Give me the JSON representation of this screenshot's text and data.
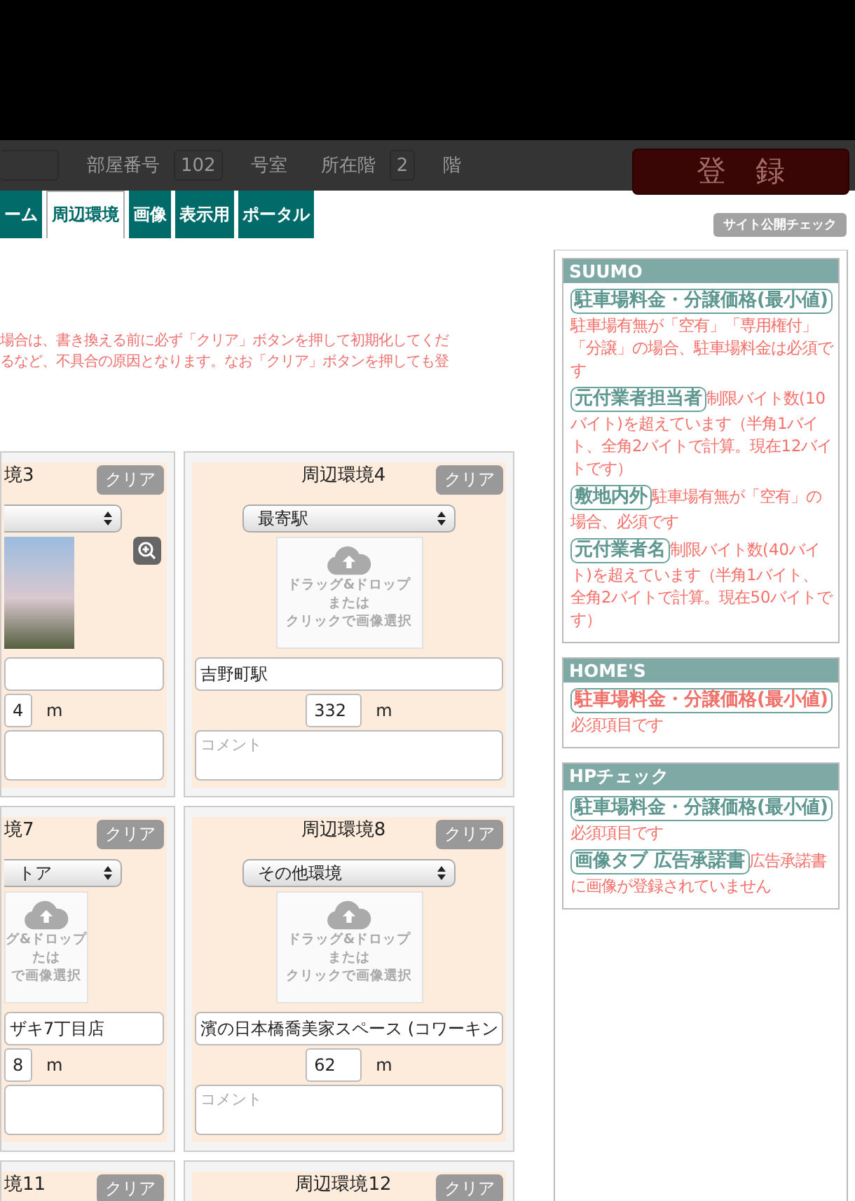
{
  "header": {
    "fields": [
      {
        "kind": "cut"
      },
      {
        "label": "部屋番号",
        "value": "102",
        "unit": "号室"
      },
      {
        "label": "所在階",
        "value": "2",
        "unit": "階"
      }
    ],
    "register_button": "登　録"
  },
  "tabs": [
    {
      "label": "ーム",
      "selected": false
    },
    {
      "label": "周辺環境",
      "selected": true
    },
    {
      "label": "画像",
      "selected": false
    },
    {
      "label": "表示用",
      "selected": false
    },
    {
      "label": "ポータル",
      "selected": false
    }
  ],
  "site_check_button": "サイト公開チェック",
  "warning": [
    "場合は、書き換える前に必ず「クリア」ボタンを押して初期化してくだ",
    "るなど、不具合の原因となります。なお「クリア」ボタンを押しても登"
  ],
  "cards": [
    {
      "kind": "partial",
      "title": "境3",
      "clear": "クリア",
      "image": {
        "kind": "photo"
      },
      "distance": "4",
      "unit": "m"
    },
    {
      "kind": "full",
      "title": "周辺環境4",
      "clear": "クリア",
      "select": "最寄駅",
      "image": {
        "kind": "upload",
        "lines": [
          "ドラッグ&ドロップ",
          "または",
          "クリックで画像選択"
        ]
      },
      "name": "吉野町駅",
      "distance": "332",
      "unit": "m",
      "comment_placeholder": "コメント"
    },
    {
      "kind": "partial",
      "title": "境7",
      "clear": "クリア",
      "select": "トア",
      "image": {
        "kind": "upload",
        "lines": [
          "グ&ドロップ",
          "たは",
          "で画像選択"
        ]
      },
      "name": "ザキ7丁目店",
      "distance": "8",
      "unit": "m"
    },
    {
      "kind": "full",
      "title": "周辺環境8",
      "clear": "クリア",
      "select": "その他環境",
      "image": {
        "kind": "upload",
        "lines": [
          "ドラッグ&ドロップ",
          "または",
          "クリックで画像選択"
        ]
      },
      "name": "濱の日本橋喬美家スペース (コワーキン",
      "distance": "62",
      "unit": "m",
      "comment_placeholder": "コメント"
    },
    {
      "kind": "partial",
      "title": "境11",
      "clear": "クリア"
    },
    {
      "kind": "full",
      "title": "周辺環境12",
      "clear": "クリア"
    }
  ],
  "sidebar": [
    {
      "title": "SUUMO",
      "items": [
        {
          "tag": "駐車場料金・分譲価格(最小値)",
          "alert": false,
          "message": "駐車場有無が「空有」「専用権付」「分譲」の場合、駐車場料金は必須です"
        },
        {
          "tag": "元付業者担当者",
          "alert": false,
          "message": "制限バイト数(10バイト)を超えています（半角1バイト、全角2バイトで計算。現在12バイトです）"
        },
        {
          "tag": "敷地内外",
          "alert": false,
          "message": "駐車場有無が「空有」の場合、必須です"
        },
        {
          "tag": "元付業者名",
          "alert": false,
          "message": "制限バイト数(40バイト)を超えています（半角1バイト、全角2バイトで計算。現在50バイトです）"
        }
      ]
    },
    {
      "title": "HOME'S",
      "items": [
        {
          "tag": "駐車場料金・分譲価格(最小値)",
          "alert": true,
          "message": "必須項目です"
        }
      ]
    },
    {
      "title": "HPチェック",
      "items": [
        {
          "tag": "駐車場料金・分譲価格(最小値)",
          "alert": false,
          "message": "必須項目です"
        },
        {
          "tag": "画像タブ 広告承諾書",
          "alert": false,
          "message": "広告承諾書に画像が登録されていません"
        }
      ]
    }
  ]
}
